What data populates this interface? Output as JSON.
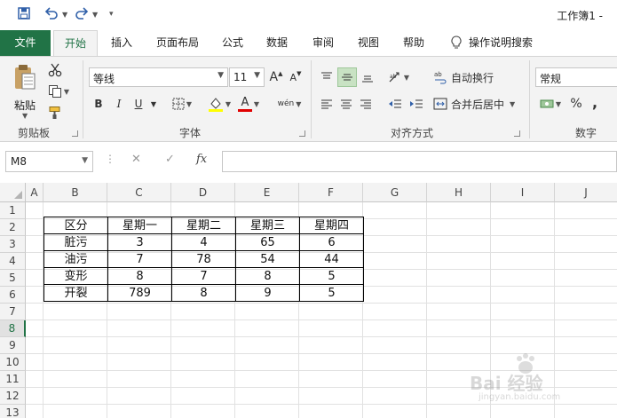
{
  "window": {
    "title": "工作簿1 -"
  },
  "tabs": [
    {
      "label": "文件"
    },
    {
      "label": "开始"
    },
    {
      "label": "插入"
    },
    {
      "label": "页面布局"
    },
    {
      "label": "公式"
    },
    {
      "label": "数据"
    },
    {
      "label": "审阅"
    },
    {
      "label": "视图"
    },
    {
      "label": "帮助"
    },
    {
      "label": "操作说明搜索"
    }
  ],
  "ribbon": {
    "clipboard": {
      "paste_label": "粘贴",
      "group_label": "剪贴板"
    },
    "font": {
      "name": "等线",
      "size": "11",
      "bold": "B",
      "italic": "I",
      "underline": "U",
      "font_color_glyph": "A",
      "phonetic_glyph": "wén",
      "grow_glyph": "A",
      "shrink_glyph": "A",
      "group_label": "字体"
    },
    "alignment": {
      "wrap_label": "自动换行",
      "merge_label": "合并后居中",
      "group_label": "对齐方式"
    },
    "number": {
      "format": "常规",
      "percent": "%",
      "comma": ",",
      "group_label": "数字"
    }
  },
  "formula_bar": {
    "name_box": "M8",
    "fx_label": "fx",
    "formula": ""
  },
  "columns": [
    "A",
    "B",
    "C",
    "D",
    "E",
    "F",
    "G",
    "H",
    "I",
    "J"
  ],
  "rows": [
    "1",
    "2",
    "3",
    "4",
    "5",
    "6",
    "7",
    "8",
    "9",
    "10",
    "11",
    "12",
    "13"
  ],
  "selected_row": "8",
  "table": {
    "header": [
      "区分",
      "星期一",
      "星期二",
      "星期三",
      "星期四"
    ],
    "rows": [
      [
        "脏污",
        "3",
        "4",
        "65",
        "6"
      ],
      [
        "油污",
        "7",
        "78",
        "54",
        "44"
      ],
      [
        "变形",
        "8",
        "7",
        "8",
        "5"
      ],
      [
        "开裂",
        "789",
        "8",
        "9",
        "5"
      ]
    ]
  },
  "watermark": {
    "text": "Bai 经验",
    "sub": "jingyan.baidu.com"
  },
  "colors": {
    "excel_green": "#217346",
    "font_red": "#e00000",
    "fill_yellow": "#ffff00"
  }
}
